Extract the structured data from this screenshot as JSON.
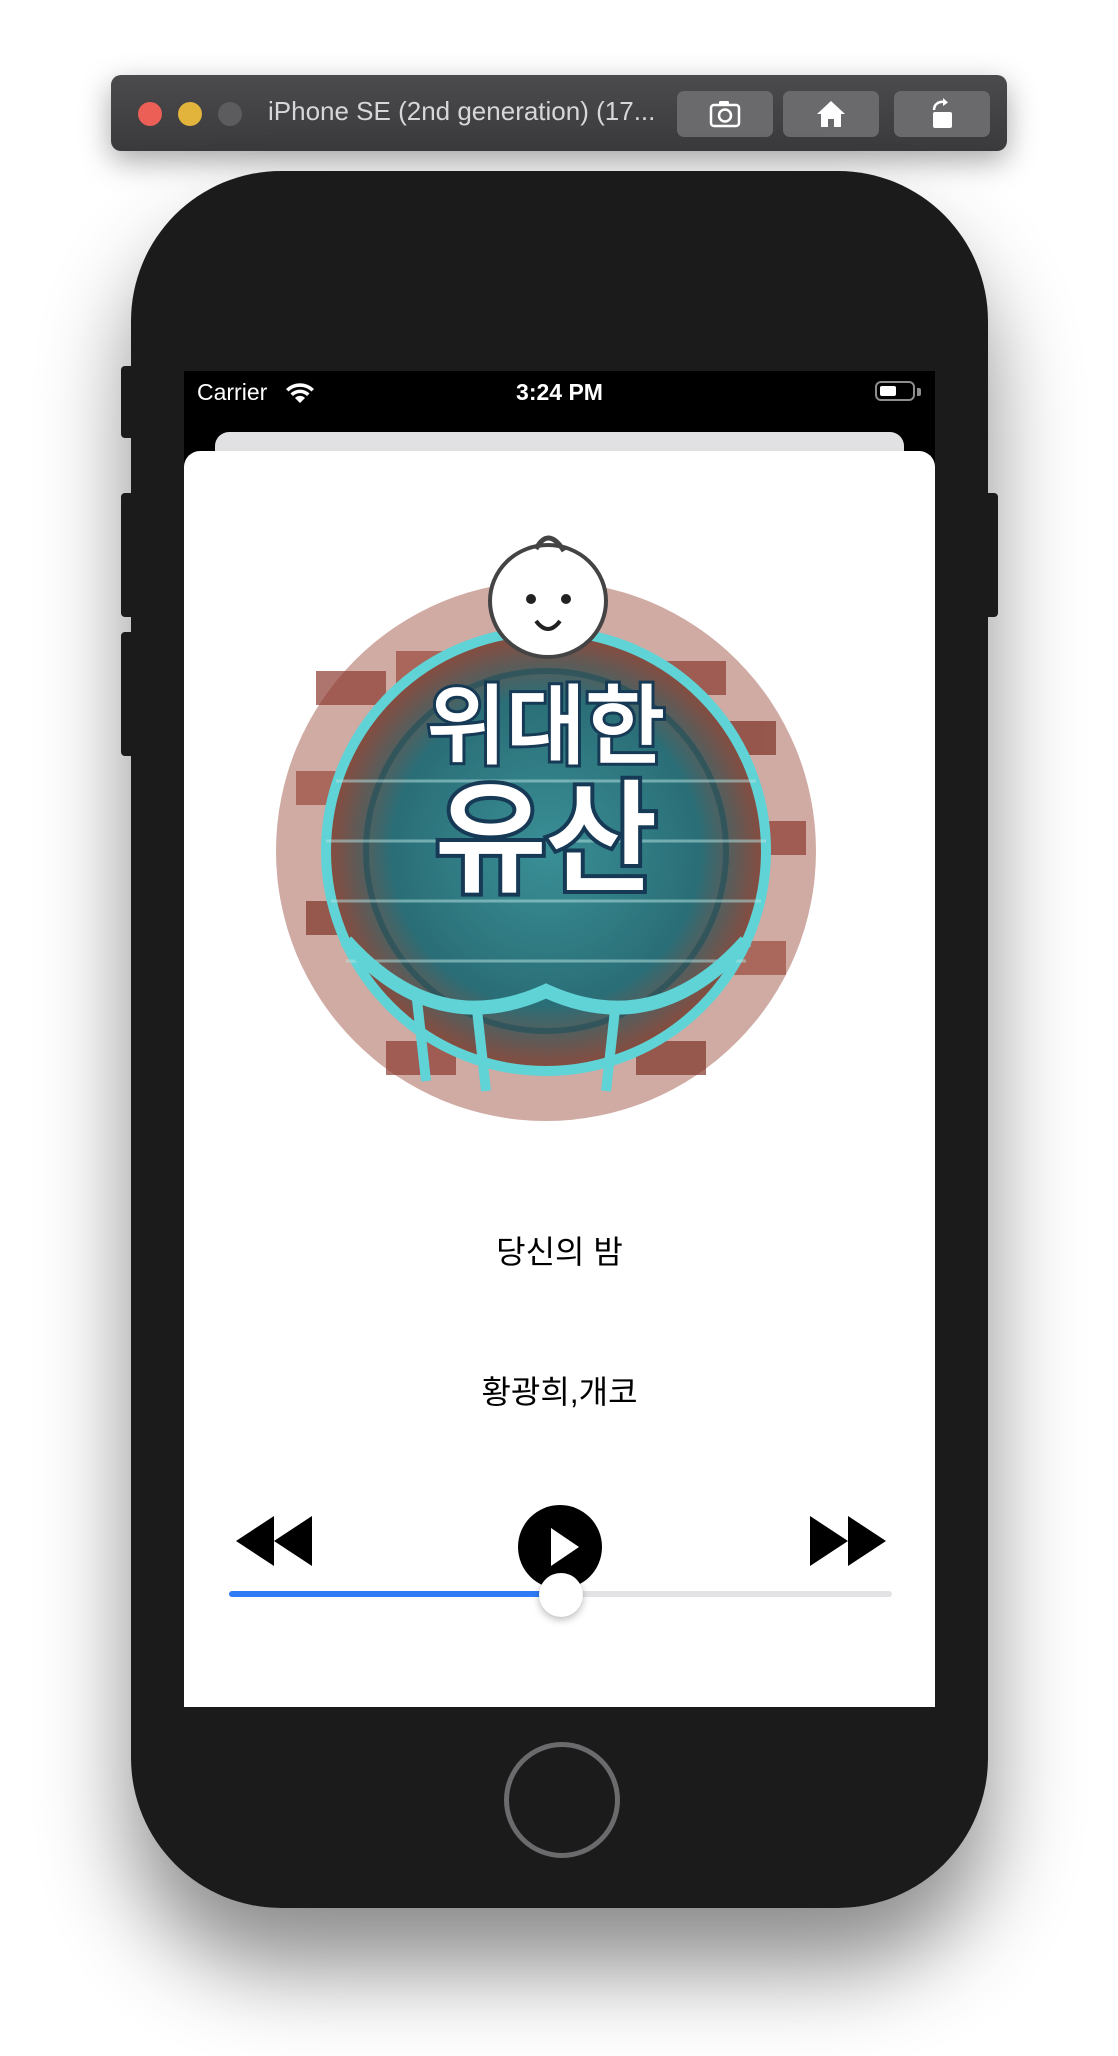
{
  "simulator": {
    "window_title": "iPhone SE (2nd generation) (17...",
    "toolbar_buttons": [
      "screenshot-icon",
      "home-icon",
      "rotate-icon"
    ]
  },
  "status_bar": {
    "carrier": "Carrier",
    "time": "3:24 PM",
    "battery_level": 0.6
  },
  "player": {
    "album_art_text_line1": "위대한",
    "album_art_text_line2": "유산",
    "song_title": "당신의 밤",
    "artist": "황광희,개코",
    "progress": 0.5,
    "controls": [
      "rewind-icon",
      "play-icon",
      "fast-forward-icon"
    ]
  },
  "colors": {
    "accent": "#2f7bf5",
    "track": "#e3e3e5",
    "phone_body": "#1b1b1c"
  }
}
